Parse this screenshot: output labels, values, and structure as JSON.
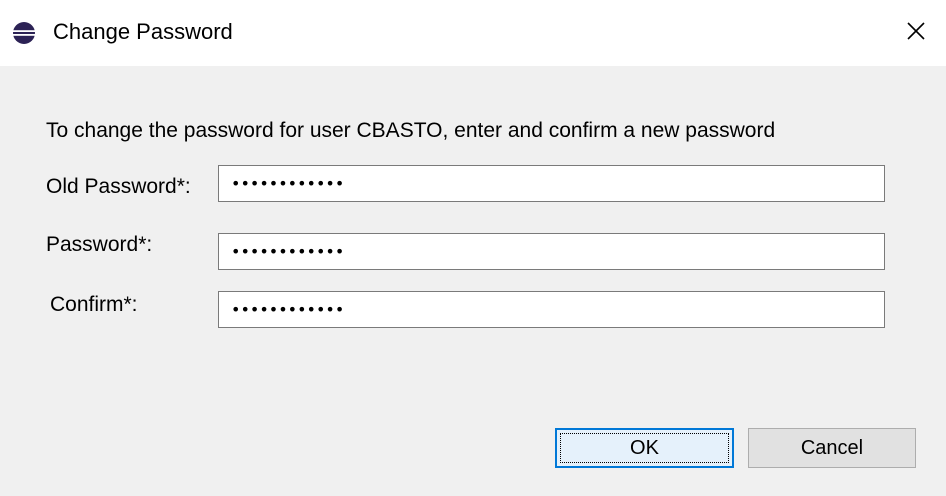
{
  "window": {
    "title": "Change Password",
    "title_icon": "eclipse-icon",
    "close_icon": "close-icon"
  },
  "dialog": {
    "instruction": "To change the password for user CBASTO, enter and confirm a new password",
    "fields": [
      {
        "label": "Old Password*:",
        "value": "••••••••••••"
      },
      {
        "label": "Password*:",
        "value": "••••••••••••"
      },
      {
        "label": "Confirm*:",
        "value": "••••••••••••"
      }
    ],
    "ok_label": "OK",
    "cancel_label": "Cancel"
  },
  "colors": {
    "dialog_background": "#f0f0f0",
    "titlebar_background": "#ffffff",
    "default_button_border": "#0078d7"
  }
}
